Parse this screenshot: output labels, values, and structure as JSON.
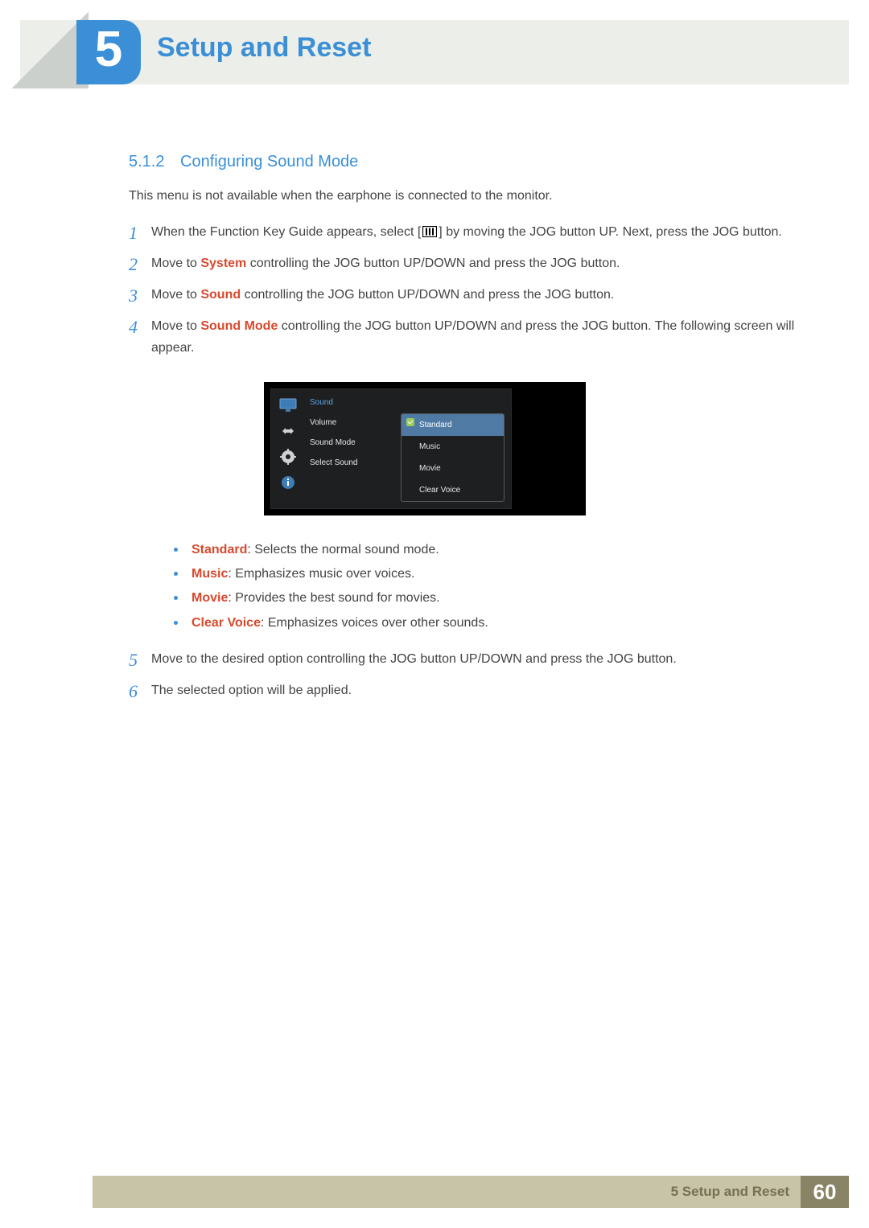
{
  "chapter": {
    "number": "5",
    "title": "Setup and Reset"
  },
  "section": {
    "number": "5.1.2",
    "title": "Configuring Sound Mode"
  },
  "lead": "This menu is not available when the earphone is connected to the monitor.",
  "steps": {
    "s1a": "When the Function Key Guide appears, select [",
    "s1b": "] by moving the JOG button UP. Next, press the JOG button.",
    "s2a": "Move to ",
    "s2kw": "System",
    "s2b": " controlling the JOG button UP/DOWN and press the JOG button.",
    "s3a": "Move to ",
    "s3kw": "Sound",
    "s3b": " controlling the JOG button UP/DOWN and press the JOG button.",
    "s4a": "Move to ",
    "s4kw": "Sound Mode",
    "s4b": " controlling the JOG button UP/DOWN and press the JOG button. The following screen will appear.",
    "s5": "Move to the desired option controlling the JOG button UP/DOWN and press the JOG button.",
    "s6": "The selected option will be applied."
  },
  "osd": {
    "category": "Sound",
    "menu": {
      "m1": "Volume",
      "m2": "Sound Mode",
      "m3": "Select Sound"
    },
    "options": {
      "o1": "Standard",
      "o2": "Music",
      "o3": "Movie",
      "o4": "Clear Voice"
    }
  },
  "desc": {
    "d1kw": "Standard",
    "d1": ": Selects the normal sound mode.",
    "d2kw": "Music",
    "d2": ": Emphasizes music over voices.",
    "d3kw": "Movie",
    "d3": ": Provides the best sound for movies.",
    "d4kw": "Clear Voice",
    "d4": ": Emphasizes voices over other sounds."
  },
  "footer": {
    "label": "5 Setup and Reset",
    "page": "60"
  }
}
